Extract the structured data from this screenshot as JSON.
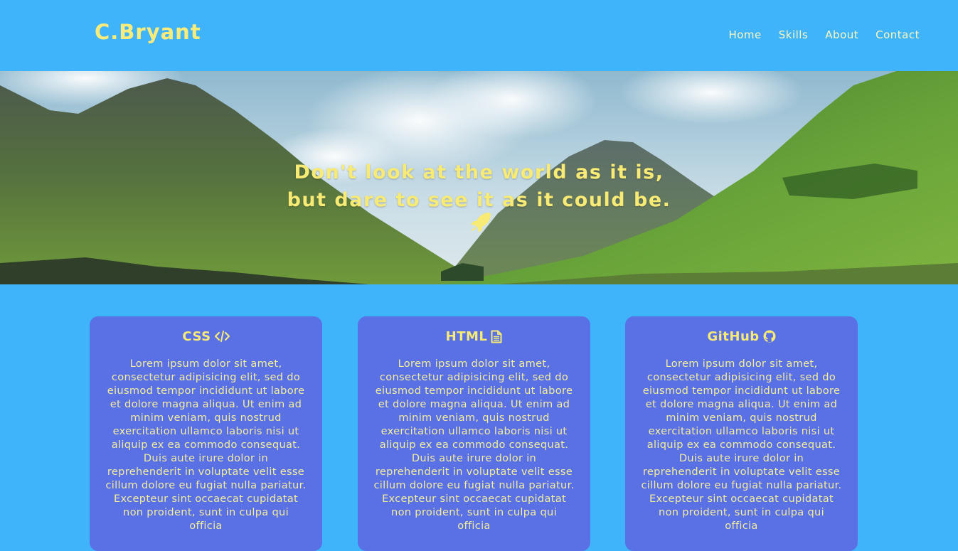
{
  "brand": {
    "name": "C.Bryant"
  },
  "nav": {
    "items": [
      {
        "label": "Home"
      },
      {
        "label": "Skills"
      },
      {
        "label": "About"
      },
      {
        "label": "Contact"
      }
    ]
  },
  "hero": {
    "line1": "Don't look at the world as it is,",
    "line2": "but dare to see it as it could be.",
    "icon": "rocket-icon"
  },
  "cards": [
    {
      "title": "CSS",
      "icon": "code-icon",
      "body": "Lorem ipsum dolor sit amet, consectetur adipisicing elit, sed do eiusmod tempor incididunt ut labore et dolore magna aliqua. Ut enim ad minim veniam, quis nostrud exercitation ullamco laboris nisi ut aliquip ex ea commodo consequat. Duis aute irure dolor in reprehenderit in voluptate velit esse cillum dolore eu fugiat nulla pariatur. Excepteur sint occaecat cupidatat non proident, sunt in culpa qui officia"
    },
    {
      "title": "HTML",
      "icon": "file-text-icon",
      "body": "Lorem ipsum dolor sit amet, consectetur adipisicing elit, sed do eiusmod tempor incididunt ut labore et dolore magna aliqua. Ut enim ad minim veniam, quis nostrud exercitation ullamco laboris nisi ut aliquip ex ea commodo consequat. Duis aute irure dolor in reprehenderit in voluptate velit esse cillum dolore eu fugiat nulla pariatur. Excepteur sint occaecat cupidatat non proident, sunt in culpa qui officia"
    },
    {
      "title": "GitHub",
      "icon": "github-icon",
      "body": "Lorem ipsum dolor sit amet, consectetur adipisicing elit, sed do eiusmod tempor incididunt ut labore et dolore magna aliqua. Ut enim ad minim veniam, quis nostrud exercitation ullamco laboris nisi ut aliquip ex ea commodo consequat. Duis aute irure dolor in reprehenderit in voluptate velit esse cillum dolore eu fugiat nulla pariatur. Excepteur sint occaecat cupidatat non proident, sunt in culpa qui officia"
    }
  ],
  "colors": {
    "background": "#3fb4fb",
    "accent": "#f7ea75",
    "card": "#5a70e5"
  }
}
